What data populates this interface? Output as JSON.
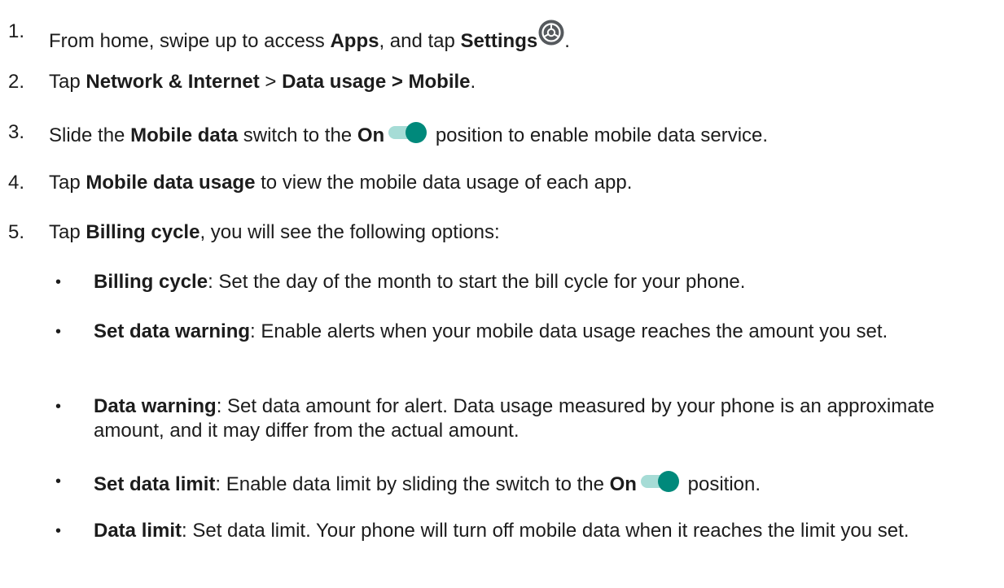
{
  "steps": [
    {
      "num": "1.",
      "t1": "From home, swipe up to access ",
      "b1": "Apps",
      "t2": ", and tap ",
      "b2": "Settings",
      "t3": "."
    },
    {
      "num": "2.",
      "t1": "Tap ",
      "b1": "Network & Internet",
      "t2": " > ",
      "b2": "Data usage > Mobile",
      "t3": "."
    },
    {
      "num": "3.",
      "t1": "Slide the ",
      "b1": "Mobile data",
      "t2": " switch to the ",
      "b2": "On",
      "t3": " position to enable mobile data service."
    },
    {
      "num": "4.",
      "t1": "Tap ",
      "b1": "Mobile data usage",
      "t2": " to view the mobile data usage of each app."
    },
    {
      "num": "5.",
      "t1": "Tap ",
      "b1": "Billing cycle",
      "t2": ", you will see the following options:"
    }
  ],
  "bullets": [
    {
      "bullet": "•",
      "b1": "Billing cycle",
      "t1": ": Set the day of the month to start the bill cycle for your phone."
    },
    {
      "bullet": "•",
      "b1": "Set data warning",
      "t1": ": Enable alerts when your mobile data usage reaches the amount you set."
    },
    {
      "bullet": "•",
      "b1": "Data warning",
      "t1": ": Set data amount for alert. Data usage measured by your phone is an approximate amount, and it may differ from the actual amount."
    },
    {
      "bullet": "•",
      "b1": "Set data limit",
      "t1": ": Enable data limit by sliding the switch to the ",
      "b2": "On",
      "t2": " position."
    },
    {
      "bullet": "•",
      "b1": "Data limit",
      "t1": ": Set data limit. Your phone will turn off mobile data when it reaches the limit you set."
    }
  ],
  "icons": {
    "settings": "gear-icon",
    "toggle": "toggle-on-icon"
  },
  "colors": {
    "text": "#1c1c1c",
    "gear_fill": "#55595d",
    "toggle_track": "#a6dcd6",
    "toggle_knob": "#00897b"
  }
}
